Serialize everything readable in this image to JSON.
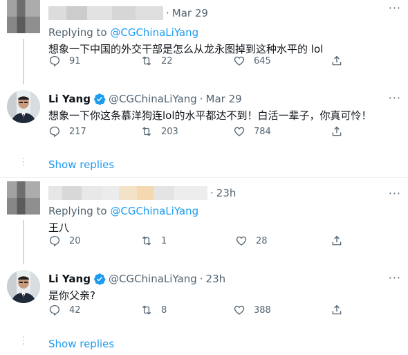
{
  "thread1": {
    "reply": {
      "time": "Mar 29",
      "replying_prefix": "Replying to",
      "replying_handle": "@CGChinaLiYang",
      "text": "想象一下中国的外交干部是怎么从龙永图掉到这种水平的 lol",
      "stats": {
        "replies": "91",
        "retweets": "22",
        "likes": "645"
      }
    },
    "response": {
      "name": "Li Yang",
      "handle": "@CGChinaLiYang",
      "time": "Mar 29",
      "text": "想象一下你这条慕洋狗连lol的水平都达不到！白活一辈子，你真可怜！",
      "stats": {
        "replies": "217",
        "retweets": "203",
        "likes": "784"
      }
    },
    "show_replies": "Show replies"
  },
  "thread2": {
    "reply": {
      "time": "23h",
      "replying_prefix": "Replying to",
      "replying_handle": "@CGChinaLiYang",
      "text": "王八",
      "stats": {
        "replies": "20",
        "retweets": "1",
        "likes": "28"
      }
    },
    "response": {
      "name": "Li Yang",
      "handle": "@CGChinaLiYang",
      "time": "23h",
      "text": "是你父亲?",
      "stats": {
        "replies": "42",
        "retweets": "8",
        "likes": "388"
      }
    },
    "show_replies": "Show replies"
  },
  "separator": "·",
  "more_icon": "···",
  "colors": {
    "link": "#1d9bf0",
    "muted": "#536471",
    "text": "#0f1419",
    "verified": "#1d9bf0"
  }
}
